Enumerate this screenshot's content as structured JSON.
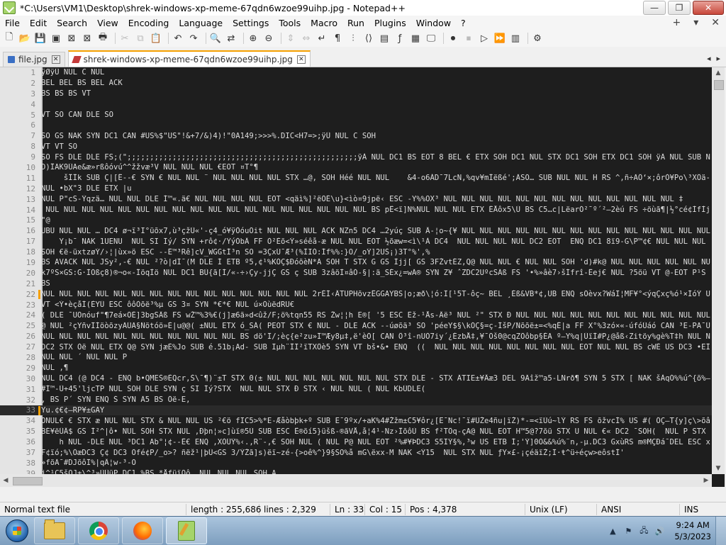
{
  "window": {
    "title": "*C:\\Users\\VM1\\Desktop\\shrek-windows-xp-meme-67qdn6wzoe99uihp.jpg - Notepad++",
    "minimize": "—",
    "maximize": "❐",
    "close": "✕"
  },
  "menu": {
    "items": [
      "File",
      "Edit",
      "Search",
      "View",
      "Encoding",
      "Language",
      "Settings",
      "Tools",
      "Macro",
      "Run",
      "Plugins",
      "Window",
      "?"
    ],
    "right": [
      "+",
      "▾",
      "✕"
    ]
  },
  "toolbar": {
    "buttons": [
      "new-file-icon",
      "open-file-icon",
      "save-icon",
      "save-all-icon",
      "close-icon",
      "close-all-icon",
      "print-icon",
      "cut-icon",
      "copy-icon",
      "paste-icon",
      "undo-icon",
      "redo-icon",
      "find-icon",
      "replace-icon",
      "zoom-in-icon",
      "zoom-out-icon",
      "sync-v-icon",
      "sync-h-icon",
      "word-wrap-icon",
      "all-chars-icon",
      "indent-guide-icon",
      "lang-icon",
      "doc-map-icon",
      "function-list-icon",
      "folder-workspace-icon",
      "monitor-icon",
      "record-macro-icon",
      "stop-macro-icon",
      "play-macro-icon",
      "run-macro-multiple-icon",
      "save-macro-icon"
    ]
  },
  "tabs": [
    {
      "label": "file.jpg",
      "active": false
    },
    {
      "label": "shrek-windows-xp-meme-67qdn6wzoe99uihp.jpg",
      "active": true
    }
  ],
  "editor": {
    "lines": [
      {
        "n": "1",
        "text": "ÿØÿÛ NUL C NUL"
      },
      {
        "n": "2",
        "text": "BEL BEL BS BEL ACK"
      },
      {
        "n": "3",
        "text": "BS BS BS VT"
      },
      {
        "n": "4",
        "text": ""
      },
      {
        "n": "5",
        "text": "VT SO CAN DLE SO"
      },
      {
        "n": "6",
        "text": ""
      },
      {
        "n": "7",
        "text": "SO GS NAK SYN DC1 CAN #US%$\"US\"!&+7/&)4)!\"0A149;>>>%.DIC<H7=>;ÿÛ NUL C SOH"
      },
      {
        "n": "8",
        "text": "VT VT SO"
      },
      {
        "n": "9",
        "text": "SO FS DLE DLE FS;(\";;;;;;;;;;;;;;;;;;;;;;;;;;;;;;;;;;;;;;;;;;;;;;;;;;;ÿÀ NUL DC1 BS EOT 8 BEL € ETX SOH DC1 NUL STX DC1 SOH ETX DC1 SOH ÿÄ NUL SUB NUL"
      },
      {
        "n": "10",
        "text": "D)ÎÃK9ÙAe&æ»rßôóvú^^žžvæ³V NUL NUL NUL €EOT ¤T°¶"
      },
      {
        "n": "11",
        "text": "     šÎÎk SUB Ç|[Ê--€ SYN € NUL NUL ¨ NUL NUL NUL NUL STX …@, SOH Héé NUL NUL    &4-o6ÁD¯7LcN,%qv¥mÎëßé';ÄSÕ… SUB NUL NUL H RS ^,ñ÷ÃÔ‘×;ôrÒ¥Po\\³XÔä-Ë4tÎe"
      },
      {
        "n": "12",
        "text": "NUL •bX\"3 DLE ETX |u"
      },
      {
        "n": "13",
        "text": "NUL P\"cS-Ýqzä… NUL NUL DLE Í™«.ä€ NUL NUL NUL NUL EOT <qäì%]²ëÕÉ\\u}<ìò¤9jpë‹ ESC -Y%%ÕX³ NUL NUL NUL NUL NUL NUL NUL NUL NUL NUL NUL NUL NUL ‡"
      },
      {
        "n": "14",
        "text": " NUL NUL NUL NUL NUL NUL NUL NUL NUL NUL NUL NUL NUL NUL NUL NUL NUL NUL BS pÊ<ï]N%NUL NUL NUL ETX ÊÅôx5\\Ü BS C5…c|LëarÓ²¯º´²–2èú FS ÷öùã¶|½°cé¢ÌfÌjcYÌfç6fÁ*|A%VTU"
      },
      {
        "n": "15",
        "text": "\"@"
      },
      {
        "n": "16",
        "text": "UBÜ NUL NUL … DC4 ø¬ï³I°üõx7,ù³çžÙ«'-ç4_ó¥ÿÔóuÖit NUL NUL NUL ACK NZn5 DC4 …2yúç SUB Â-¦o~{¥ NUL NUL NUL NUL NUL NUL NUL NUL NUL NUL NUL NUL NUL NUL"
      },
      {
        "n": "17",
        "text": "    Y¡b¯ NAK 1UENU  NUL SI Ïý/ SYN +rô¢·/ŸýÒbÂ FF Ò²Èõ<Ý»séêå-æ NUL NUL EOT ½õæw=<ì\\¹À DC4  NUL NUL NUL NUL DC2 EOT  ENQ DC1 8ï9-G\\P™¢€ NUL NUL NUL NUL NUL NUL"
      },
      {
        "n": "18",
        "text": "SOH €ë-üxtzøÝ/›¦|ùx»ö ESC --Ê™³Rê]cV_WGGtÍ³n SO =3ÇxÚ¯Æ³(%ÌIÓ:Íf%%:}O/_oÝ]2UŠ¡)3T°%',%"
      },
      {
        "n": "19",
        "text": "BS AVACK NUL JSy²,-€ NUL ²?ò|dÍ¯(M DLE Í ETB º5,¢¹%KÓÇ$ÐóõèN*Ä SOH T STX G GS Ìjj[ GS 3FŽvtÉZ,Q@ NUL NUL € NUL NUL SOH 'd)#k@ NUL NUL NUL NUL NUL NUL NUL NUL"
      },
      {
        "n": "20",
        "text": "k7ºS×GS:G·ÌÓßç8)®¬o«-ÎöqÌö NUL DC1 BÙ{ã[Í/«-÷›Çy-jjÇ GS ç SUB 3zâöÌ¤âÓ-§|:ä_SÈx¿=wÄ® SYN Z¥ ˆZDC2UºcSÄß FS '•%»âè7›šÍfrî-Êej€ NUL ?5öü VT @-EOT P¹S"
      },
      {
        "n": "21",
        "text": "BS"
      },
      {
        "n": "22",
        "text": "NUL NUL NUL NUL NUL NUL NUL NUL NUL NUL NUL NUL NUL NUL NUL 2rÈÍ‹ÂTUPHõvzÊGGAYBS|o;æð\\¦ó:Ï[¹5T-ôç~ BEL ¸Èß&VB*¢,UB ENQ sÔèvx?WáÏ¦MF¥°<ýqÇxç%ó¹×ÍóÝ US fíÏ§ US 3ô"
      },
      {
        "n": "23",
        "text": "VT <Ý•èçåÍ(ÈYÛ ESC ôôÒõë³%µ GS 3¤ SYN *€*€ NUL ú×ÕùëdRU€"
      },
      {
        "n": "24",
        "text": "( DLE ¯UÕnóuf\"¶7eá×ÕÈ]3bgSÂß FS wŽ™%3%€(j]æ6ã»d<ûž/F;ö%tqn55 RS Žw¦¦h E®[ '5 ESC Ëž-¹Ås-Âë³ NUL ²\" STX Ð NUL NUL NUL NUL NUL NUL NUL NUL NUL NUL NUL ETX ³"
      },
      {
        "n": "25",
        "text": "@ NUL ²çYñvÏÍöòõzyÃÜÃ§Ñötóö»È|u@@( ±NUL ETX ó_SÁ( PEOT STX € NUL - DLE ACK --úøõä³ SO 'péeY$§\\kÓÇ§=ç-ÍšP/Ñõõë±=<%qÊ|a FF X°%3zó×«-úfóÙáó CAN ³E-PA¯Ü"
      },
      {
        "n": "26",
        "text": "NUL NUL NUL NUL NUL NUL NUL NUL NUL NUL NUL BS dö'Ï/;èç{e²zu»Ï™Æy8µ‡,ë'èÓ[ CAN Ô³î-nUÓ7iy´¿ÉzbÅ‡,¥¯Õš0@cqZÖôbp§ÉA º–Y%q|ÜïÍ#P¿@åß‹Zitöy%gè%T‡h NUL N"
      },
      {
        "n": "27",
        "text": "DC2 STX Òë NUL ETX Q@ SYN jæÈ%Jo SUB é.51b¡Ad- SUB Ïµh¨ÎÏ²ïTXÔè5 SYN VT bš•&• ENQ  ((  NUL NUL NUL NUL NUL NUL NUL NUL EOT NUL NUL BS cWÈ US DC3 •ËÎòçppÔ Æ[Ì~pk"
      },
      {
        "n": "28",
        "text": "NUL NUL ´ NUL NUL P"
      },
      {
        "n": "29",
        "text": "NUL ,¶"
      },
      {
        "n": "30",
        "text": "NUL DC4 (@ DC4 - ENQ b•QMEŠ®ÈQcr,Š\\¯¶)¨±T STX 0(± NUL NUL NUL NUL NUL NUL NUL STX DLE - STX ÄTIE±¥Âæ3 DEL 9Äîž™a5-LNrð¶ SYN 5 STX [ NAK šÀqÓ%%ú^{õ%—µ™´æÕ"
      },
      {
        "n": "31",
        "text": "#Í™-Ù+45'ljcTP NUL SOH DLE SYN ç SI Íý?STX  NUL NUL STX Ð STX ‹ NUL NUL ( NUL KbÚDLE("
      },
      {
        "n": "32",
        "text": ", BS P´ SYN ENQ Š SYN Ä5 BS Öë-E,"
      },
      {
        "n": "33",
        "text": "Yu.¢€¢–RP¥±GAY"
      },
      {
        "n": "34",
        "text": "ÕNUL€ € STX æ NUL NUL STX & NUL NUL US ²€ö fIC5>%*E-Æåòbþk+º SUB Ë¯9ºx/+aK%4#Žžm±C5¥ôr¿[Ë¯Nc!¯ï#ÜŽe4ñu|ïŽ)*-=<ïÙú~lÝ RS FS õžvcÍ% US #( ÔÇ–T{y]ç\\>õâ÷™ùß#ù\\=ÜVI"
      },
      {
        "n": "35",
        "text": "BÉ¥ëÛÂ$ GS Í²^|ô• NUL SOH STX NUL ,Ðþn¦»c]ùï®5Ù SUB ESC Ê®õí5}üšß-®ãVÅ,å¦4¹-Nz›ÎõôÙ BS f²TÔq-çA@ NUL EOT H™5@?7õü STX U NUL €« DC2 ¯SOH(  NUL P STX ,"
      },
      {
        "n": "36",
        "text": "    h NUL -DLE NUL ³DC1 Ab°¦¢--Ê€ ENQ ,XÒÜÝ%‹.,R¨-,€ SOH NUL ( NUL P@ NUL EOT ²%#¥ÞDC3 S5ÏÝ§%,³w US ETB Í;'Ý]0Ö&&%ú%¨n,-µ.DC3 GxùRS m®MÇÐá¯DEL ESC x"
      },
      {
        "n": "37",
        "text": "F¢ïó;%\\ÖæDC3 Ç¢ DC3 Õfé¢P/_o>? ñëž¹|þÜ<GS 3/ÝŽã]s)ëï~zé-{>oê%^}9§SO%å mG\\ëxx-M NAK <Ý15  NUL STX NUL ƒY×£-¡çéäïŽ;Ï·ŧ^ü÷éçw>eôstÍ'"
      },
      {
        "n": "38",
        "text": "»fõÄ¯#DJõôÏ%|qÂ¦w-³-O"
      },
      {
        "n": "39",
        "text": "j^¹C5šÕJ±\\^³»ÙÜüP DC1 %BS *ÅfüïÕô… NUL NUL NUL SOH A"
      }
    ]
  },
  "status": {
    "type": "Normal text file",
    "length": "length : 255,686",
    "lines": "lines : 2,329",
    "ln": "Ln : 33",
    "col": "Col : 15",
    "pos": "Pos : 4,378",
    "eol": "Unix (LF)",
    "encoding": "ANSI",
    "mode": "INS"
  },
  "taskbar": {
    "apps": [
      "explorer-icon",
      "chrome-icon",
      "firefox-icon",
      "notepadpp-icon"
    ],
    "time": "9:24 AM",
    "date": "5/3/2023"
  }
}
